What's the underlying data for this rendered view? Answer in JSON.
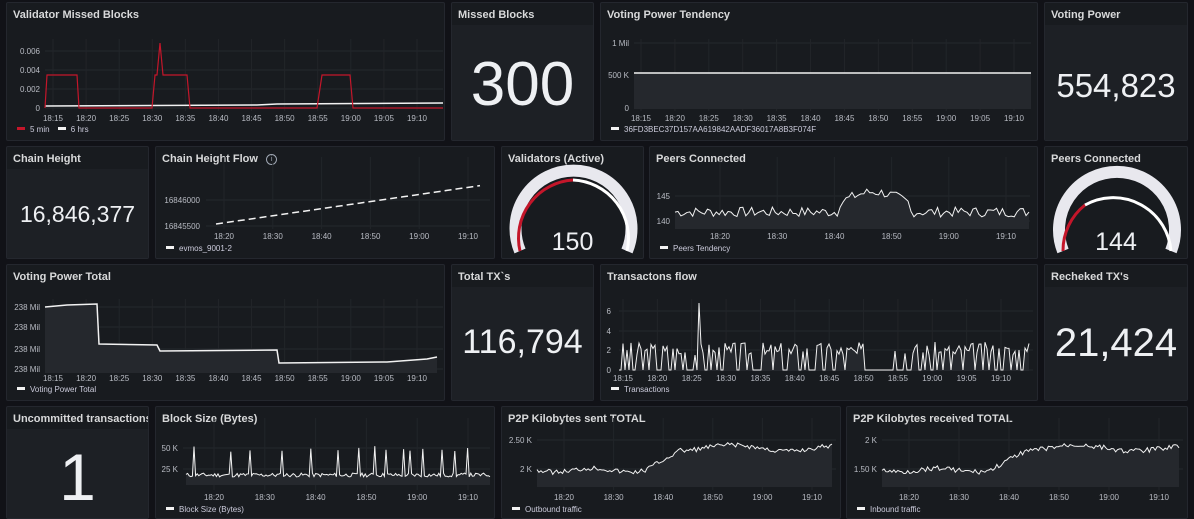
{
  "colors": {
    "red": "#c4162a",
    "white": "#f2f2f2",
    "grey_fill": "#2b2e33",
    "gauge_track": "#e8e8ee"
  },
  "panels": {
    "validator_missed": {
      "title": "Validator Missed Blocks",
      "y_ticks": [
        "0.006",
        "0.004",
        "0.002",
        "0"
      ],
      "x_ticks": [
        "18:15",
        "18:20",
        "18:25",
        "18:30",
        "18:35",
        "18:40",
        "18:45",
        "18:50",
        "18:55",
        "19:00",
        "19:05",
        "19:10"
      ],
      "legend": [
        "5 min",
        "6 hrs"
      ]
    },
    "missed_blocks": {
      "title": "Missed Blocks",
      "value": "300"
    },
    "voting_power_tendency": {
      "title": "Voting Power Tendency",
      "y_ticks": [
        "1 Mil",
        "500 K",
        "0"
      ],
      "x_ticks": [
        "18:15",
        "18:20",
        "18:25",
        "18:30",
        "18:35",
        "18:40",
        "18:45",
        "18:50",
        "18:55",
        "19:00",
        "19:05",
        "19:10"
      ],
      "legend": "36FD3BEC37D157AA619842AADF36017A8B3F074F"
    },
    "voting_power": {
      "title": "Voting Power",
      "value": "554,823"
    },
    "chain_height": {
      "title": "Chain Height",
      "value": "16,846,377"
    },
    "chain_height_flow": {
      "title": "Chain Height Flow",
      "info_icon": "i",
      "y_ticks": [
        "16846000",
        "16845500"
      ],
      "x_ticks": [
        "18:20",
        "18:30",
        "18:40",
        "18:50",
        "19:00",
        "19:10"
      ],
      "legend": "evmos_9001-2"
    },
    "validators_active": {
      "title": "Validators (Active)",
      "value": "150"
    },
    "peers_connected_graph": {
      "title": "Peers Connected",
      "y_ticks": [
        "145",
        "140"
      ],
      "x_ticks": [
        "18:20",
        "18:30",
        "18:40",
        "18:50",
        "19:00",
        "19:10"
      ],
      "legend": "Peers Tendency"
    },
    "peers_connected_gauge": {
      "title": "Peers Connected",
      "value": "144"
    },
    "voting_power_total": {
      "title": "Voting Power Total",
      "y_ticks": [
        "238 Mil",
        "238 Mil",
        "238 Mil",
        "238 Mil"
      ],
      "x_ticks": [
        "18:15",
        "18:20",
        "18:25",
        "18:30",
        "18:35",
        "18:40",
        "18:45",
        "18:50",
        "18:55",
        "19:00",
        "19:05",
        "19:10"
      ],
      "legend": "Voting Power Total"
    },
    "total_tx": {
      "title": "Total TX`s",
      "value": "116,794"
    },
    "transactions_flow": {
      "title": "Transactons flow",
      "y_ticks": [
        "6",
        "4",
        "2",
        "0"
      ],
      "x_ticks": [
        "18:15",
        "18:20",
        "18:25",
        "18:30",
        "18:35",
        "18:40",
        "18:45",
        "18:50",
        "18:55",
        "19:00",
        "19:05",
        "19:10"
      ],
      "legend": "Transactions"
    },
    "rechecked_tx": {
      "title": "Recheked TX's",
      "value": "21,424"
    },
    "uncommitted_tx": {
      "title": "Uncommitted transactions",
      "value": "1"
    },
    "block_size": {
      "title": "Block Size (Bytes)",
      "y_ticks": [
        "50 K",
        "25 K"
      ],
      "x_ticks": [
        "18:20",
        "18:30",
        "18:40",
        "18:50",
        "19:00",
        "19:10"
      ],
      "legend": "Block Size (Bytes)"
    },
    "p2p_sent": {
      "title": "P2P Kilobytes sent TOTAL",
      "y_ticks": [
        "2.50 K",
        "2 K"
      ],
      "x_ticks": [
        "18:20",
        "18:30",
        "18:40",
        "18:50",
        "19:00",
        "19:10"
      ],
      "legend": "Outbound traffic"
    },
    "p2p_received": {
      "title": "P2P Kilobytes received TOTAL",
      "y_ticks": [
        "2 K",
        "1.50 K"
      ],
      "x_ticks": [
        "18:20",
        "18:30",
        "18:40",
        "18:50",
        "19:00",
        "19:10"
      ],
      "legend": "Inbound traffic"
    }
  }
}
